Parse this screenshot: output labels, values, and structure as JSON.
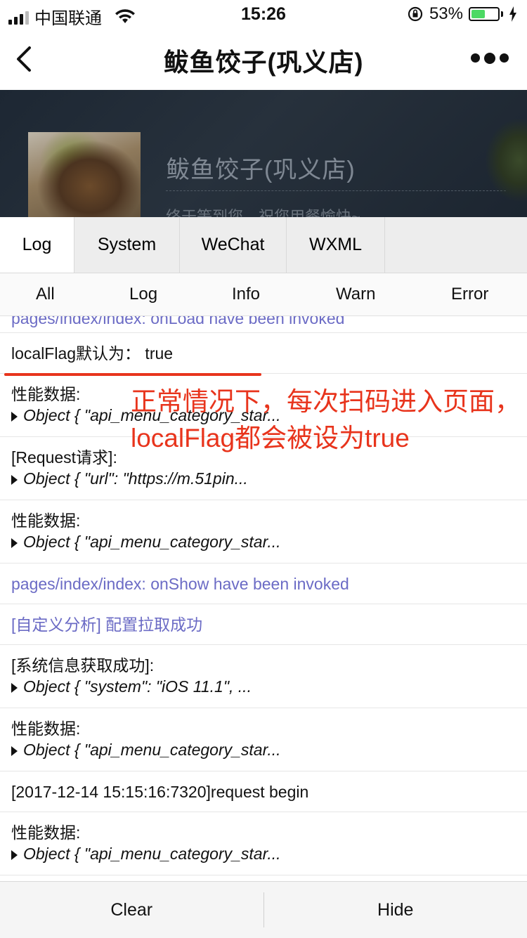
{
  "status_bar": {
    "carrier": "中国联通",
    "time": "15:26",
    "battery_percent": "53%",
    "battery_level": 0.53
  },
  "nav": {
    "title": "鲅鱼饺子(巩义店)"
  },
  "store": {
    "name": "鲅鱼饺子(巩义店)",
    "slogan": "终于等到您，祝您用餐愉快~"
  },
  "tabs": [
    "Log",
    "System",
    "WeChat",
    "WXML"
  ],
  "filters": [
    "All",
    "Log",
    "Info",
    "Warn",
    "Error"
  ],
  "logs": {
    "partial": "pages/index/index: onLoad have been invoked",
    "l1": "localFlag默认为：  true",
    "l2_label": "性能数据:",
    "l2_obj": "Object { \"api_menu_category_star...",
    "l3_label": "[Request请求]:",
    "l3_obj": "Object { \"url\": \"https://m.51pin...",
    "l4_label": "性能数据:",
    "l4_obj": "Object { \"api_menu_category_star...",
    "l5": "pages/index/index: onShow have been invoked",
    "l6": "[自定义分析] 配置拉取成功",
    "l7_label": "[系统信息获取成功]:",
    "l7_obj": "Object { \"system\": \"iOS 11.1\", ...",
    "l8_label": "性能数据:",
    "l8_obj": "Object { \"api_menu_category_star...",
    "l9": "[2017-12-14 15:15:16:7320]request begin",
    "l10_label": "性能数据:",
    "l10_obj": "Object { \"api_menu_category_star..."
  },
  "annotation": {
    "text": "正常情况下，每次扫码进入页面，localFlag都会被设为true",
    "color": "#e8341c"
  },
  "buttons": {
    "clear": "Clear",
    "hide": "Hide"
  }
}
